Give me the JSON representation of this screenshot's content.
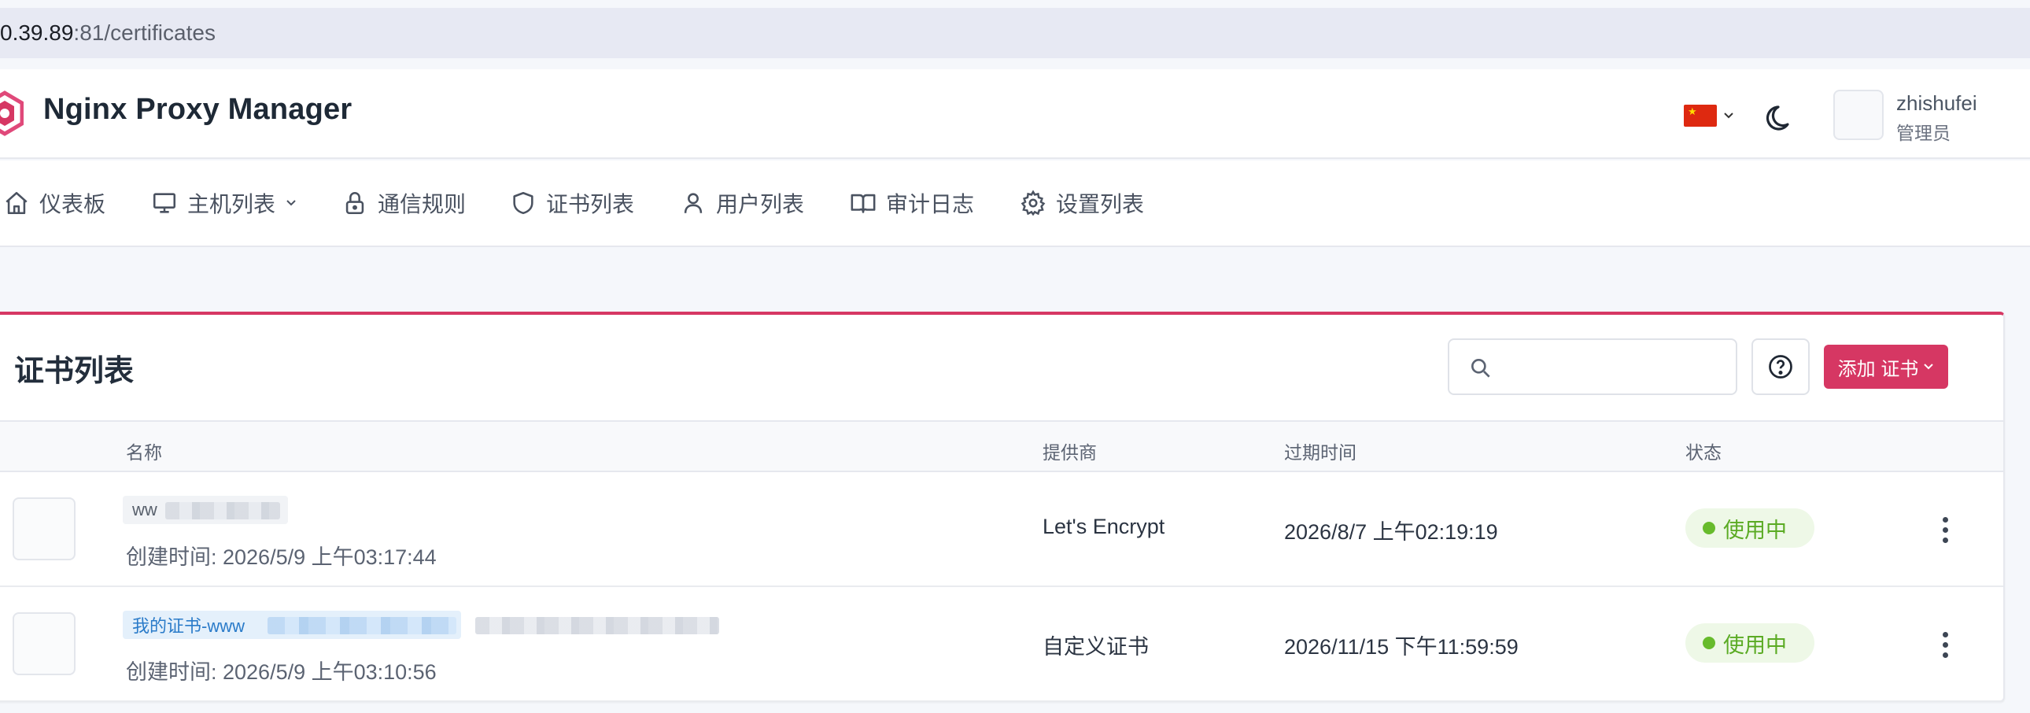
{
  "browser": {
    "url_host": "0.39.89",
    "url_path": ":81/certificates"
  },
  "header": {
    "app_title": "Nginx Proxy Manager",
    "language_flag": "cn-flag",
    "theme_icon": "moon-icon",
    "user": {
      "name": "zhishufei",
      "role": "管理员"
    }
  },
  "nav": {
    "items": [
      {
        "label": "仪表板",
        "icon": "home-icon"
      },
      {
        "label": "主机列表",
        "icon": "monitor-icon",
        "has_dropdown": true
      },
      {
        "label": "通信规则",
        "icon": "lock-icon"
      },
      {
        "label": "证书列表",
        "icon": "shield-icon"
      },
      {
        "label": "用户列表",
        "icon": "user-icon"
      },
      {
        "label": "审计日志",
        "icon": "book-icon"
      },
      {
        "label": "设置列表",
        "icon": "gear-icon"
      }
    ]
  },
  "colors": {
    "accent": "#d63763",
    "status_green": "#5bab24"
  },
  "certificates": {
    "title": "证书列表",
    "search_placeholder": "",
    "add_button_label": "添加 证书",
    "columns": {
      "name": "名称",
      "provider": "提供商",
      "expires": "过期时间",
      "status": "状态"
    },
    "rows": [
      {
        "name_visible": "ww",
        "created": "创建时间: 2026/5/9 上午03:17:44",
        "provider": "Let's Encrypt",
        "expires": "2026/8/7 上午02:19:19",
        "status": "使用中"
      },
      {
        "name_visible": "我的证书-www",
        "created": "创建时间: 2026/5/9 上午03:10:56",
        "provider": "自定义证书",
        "expires": "2026/11/15 下午11:59:59",
        "status": "使用中"
      }
    ]
  }
}
